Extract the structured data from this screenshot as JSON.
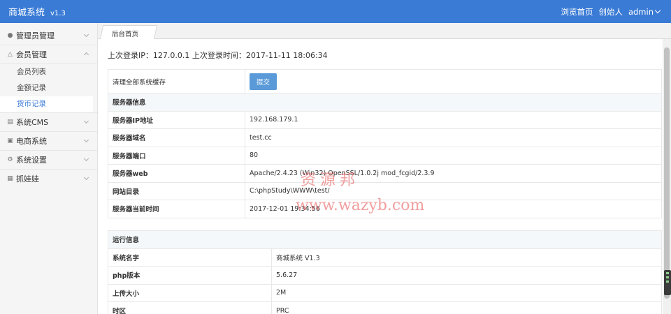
{
  "header": {
    "brand": "商城系统",
    "version": "v1.3",
    "nav_browse": "浏览首页",
    "nav_founder": "创始人",
    "nav_user": "admin"
  },
  "sidebar": {
    "items": [
      {
        "label": "管理员管理",
        "icon": "user-icon",
        "expanded": false
      },
      {
        "label": "会员管理",
        "icon": "warning-icon",
        "expanded": true,
        "children": [
          {
            "label": "会员列表",
            "active": false
          },
          {
            "label": "金额记录",
            "active": false
          },
          {
            "label": "货币记录",
            "active": true
          }
        ]
      },
      {
        "label": "系统CMS",
        "icon": "list-icon",
        "expanded": false
      },
      {
        "label": "电商系统",
        "icon": "store-icon",
        "expanded": false
      },
      {
        "label": "系统设置",
        "icon": "gear-icon",
        "expanded": false
      },
      {
        "label": "抓娃娃",
        "icon": "grid-icon",
        "expanded": false
      }
    ]
  },
  "tabs": [
    {
      "label": "后台首页",
      "active": true
    }
  ],
  "main": {
    "last_login": "上次登录IP：127.0.0.1 上次登录时间：2017-11-11 18:06:34",
    "cache_label": "清理全部系统缓存",
    "submit_label": "提交",
    "server_section": "服务器信息",
    "server_rows": [
      {
        "key": "服务器IP地址",
        "value": "192.168.179.1"
      },
      {
        "key": "服务器域名",
        "value": "test.cc"
      },
      {
        "key": "服务器端口",
        "value": "80"
      },
      {
        "key": "服务器web",
        "value": "Apache/2.4.23 (Win32) OpenSSL/1.0.2j mod_fcgid/2.3.9"
      },
      {
        "key": "网站目录",
        "value": "C:\\phpStudy\\WWW\\test/"
      },
      {
        "key": "服务器当前时间",
        "value": "2017-12-01 19:34:56"
      }
    ],
    "runtime_section": "运行信息",
    "runtime_rows": [
      {
        "key": "系统名字",
        "value": "商城系统 V1.3"
      },
      {
        "key": "php版本",
        "value": "5.6.27"
      },
      {
        "key": "上传大小",
        "value": "2M"
      },
      {
        "key": "时区",
        "value": "PRC"
      }
    ]
  },
  "watermark": {
    "chars": "资源邦",
    "url": "www.wazyb.com"
  },
  "colors": {
    "header_bg": "#3a7bd5",
    "active_link": "#3a7bd5",
    "button_bg": "#5a9ad8",
    "section_bg": "#f4f8fb"
  }
}
